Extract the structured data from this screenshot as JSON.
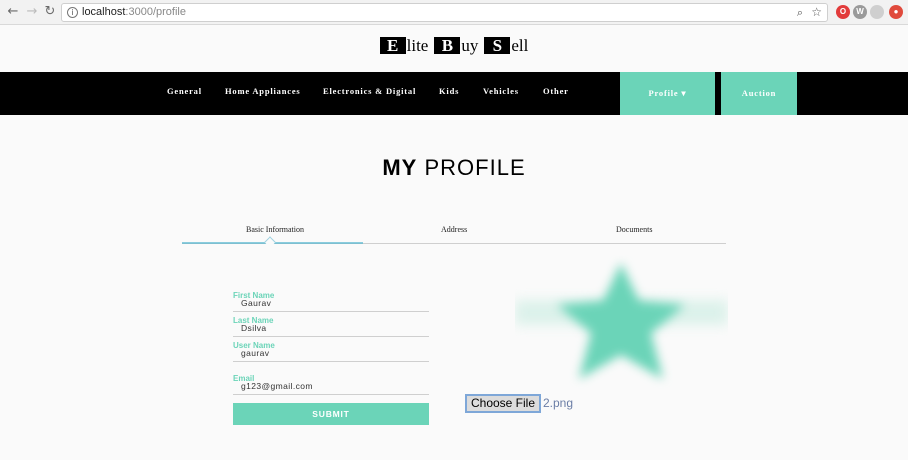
{
  "browser": {
    "url_host": "localhost",
    "url_rest": ":3000/profile"
  },
  "logo": {
    "letters": [
      "E",
      "B",
      "S"
    ],
    "rests": [
      "lite",
      "uy",
      "ell"
    ]
  },
  "nav": {
    "items": [
      "General",
      "Home Appliances",
      "Electronics & Digital",
      "Kids",
      "Vehicles",
      "Other"
    ],
    "profile": "Profile ▾",
    "auction": "Auction"
  },
  "title": {
    "bold": "MY",
    "light": "PROFILE"
  },
  "tabs": [
    "Basic Information",
    "Address",
    "Documents"
  ],
  "form": {
    "first_name_label": "First Name",
    "first_name_value": "Gaurav",
    "last_name_label": "Last Name",
    "last_name_value": "Dsilva",
    "user_name_label": "User Name",
    "user_name_value": "gaurav",
    "email_label": "Email",
    "email_value": "g123@gmail.com",
    "submit": "SUBMIT"
  },
  "file": {
    "button": "Choose File",
    "name": "2.png"
  },
  "colors": {
    "accent": "#6bd4b8",
    "navbar": "#000000"
  }
}
